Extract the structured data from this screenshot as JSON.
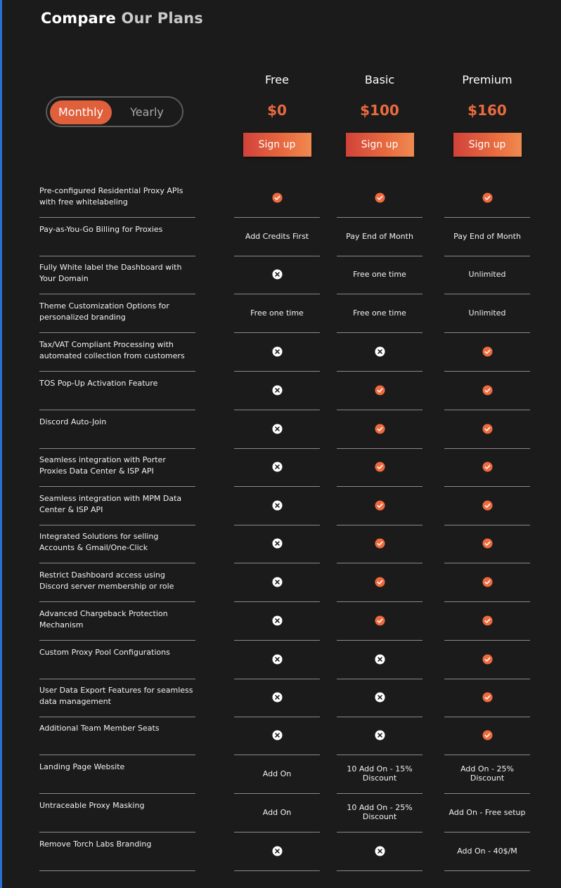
{
  "title": {
    "part1": "Compare",
    "part2": "Our Plans"
  },
  "billing_toggle": {
    "monthly": "Monthly",
    "yearly": "Yearly",
    "selected": "Monthly"
  },
  "colors": {
    "accent": "#ea6a3f",
    "check": "#ef6a3d",
    "background": "#1b1b1b"
  },
  "plans": [
    {
      "name": "Free",
      "price": "$0",
      "cta": "Sign up"
    },
    {
      "name": "Basic",
      "price": "$100",
      "cta": "Sign up"
    },
    {
      "name": "Premium",
      "price": "$160",
      "cta": "Sign up"
    }
  ],
  "features": [
    {
      "label": "Pre-configured Residential Proxy APIs with free whitelabeling",
      "values": [
        {
          "type": "check"
        },
        {
          "type": "check"
        },
        {
          "type": "check"
        }
      ]
    },
    {
      "label": "Pay-as-You-Go Billing for Proxies",
      "values": [
        {
          "type": "text",
          "text": "Add Credits First"
        },
        {
          "type": "text",
          "text": "Pay End of Month"
        },
        {
          "type": "text",
          "text": "Pay End of Month"
        }
      ]
    },
    {
      "label": "Fully White label the Dashboard with Your Domain",
      "values": [
        {
          "type": "cross"
        },
        {
          "type": "text",
          "text": "Free one time"
        },
        {
          "type": "text",
          "text": "Unlimited"
        }
      ]
    },
    {
      "label": "Theme Customization Options for personalized branding",
      "values": [
        {
          "type": "text",
          "text": "Free one time"
        },
        {
          "type": "text",
          "text": "Free one time"
        },
        {
          "type": "text",
          "text": "Unlimited"
        }
      ]
    },
    {
      "label": "Tax/VAT Compliant Processing with automated collection from customers",
      "values": [
        {
          "type": "cross"
        },
        {
          "type": "cross"
        },
        {
          "type": "check"
        }
      ]
    },
    {
      "label": "TOS Pop-Up Activation Feature",
      "values": [
        {
          "type": "cross"
        },
        {
          "type": "check"
        },
        {
          "type": "check"
        }
      ]
    },
    {
      "label": "Discord Auto-Join",
      "values": [
        {
          "type": "cross"
        },
        {
          "type": "check"
        },
        {
          "type": "check"
        }
      ]
    },
    {
      "label": "Seamless integration with Porter Proxies Data Center & ISP API",
      "values": [
        {
          "type": "cross"
        },
        {
          "type": "check"
        },
        {
          "type": "check"
        }
      ]
    },
    {
      "label": "Seamless integration with MPM Data Center & ISP API",
      "values": [
        {
          "type": "cross"
        },
        {
          "type": "check"
        },
        {
          "type": "check"
        }
      ]
    },
    {
      "label": "Integrated Solutions for selling Accounts & Gmail/One-Click",
      "values": [
        {
          "type": "cross"
        },
        {
          "type": "check"
        },
        {
          "type": "check"
        }
      ]
    },
    {
      "label": "Restrict Dashboard access using Discord server membership or role",
      "values": [
        {
          "type": "cross"
        },
        {
          "type": "check"
        },
        {
          "type": "check"
        }
      ]
    },
    {
      "label": "Advanced Chargeback Protection Mechanism",
      "values": [
        {
          "type": "cross"
        },
        {
          "type": "check"
        },
        {
          "type": "check"
        }
      ]
    },
    {
      "label": "Custom Proxy Pool Configurations",
      "values": [
        {
          "type": "cross"
        },
        {
          "type": "cross"
        },
        {
          "type": "check"
        }
      ]
    },
    {
      "label": "User Data Export Features for seamless data management",
      "values": [
        {
          "type": "cross"
        },
        {
          "type": "cross"
        },
        {
          "type": "check"
        }
      ]
    },
    {
      "label": "Additional Team Member Seats",
      "values": [
        {
          "type": "cross"
        },
        {
          "type": "cross"
        },
        {
          "type": "check"
        }
      ]
    },
    {
      "label": "Landing Page Website",
      "values": [
        {
          "type": "text",
          "text": "Add On"
        },
        {
          "type": "text",
          "text": "10 Add On - 15% Discount"
        },
        {
          "type": "text",
          "text": "Add On - 25% Discount"
        }
      ]
    },
    {
      "label": "Untraceable Proxy Masking",
      "values": [
        {
          "type": "text",
          "text": "Add On"
        },
        {
          "type": "text",
          "text": "10 Add On - 25% Discount"
        },
        {
          "type": "text",
          "text": "Add On - Free setup"
        }
      ]
    },
    {
      "label": "Remove Torch Labs Branding",
      "values": [
        {
          "type": "cross"
        },
        {
          "type": "cross"
        },
        {
          "type": "text",
          "text": "Add On - 40$/M"
        }
      ]
    }
  ]
}
